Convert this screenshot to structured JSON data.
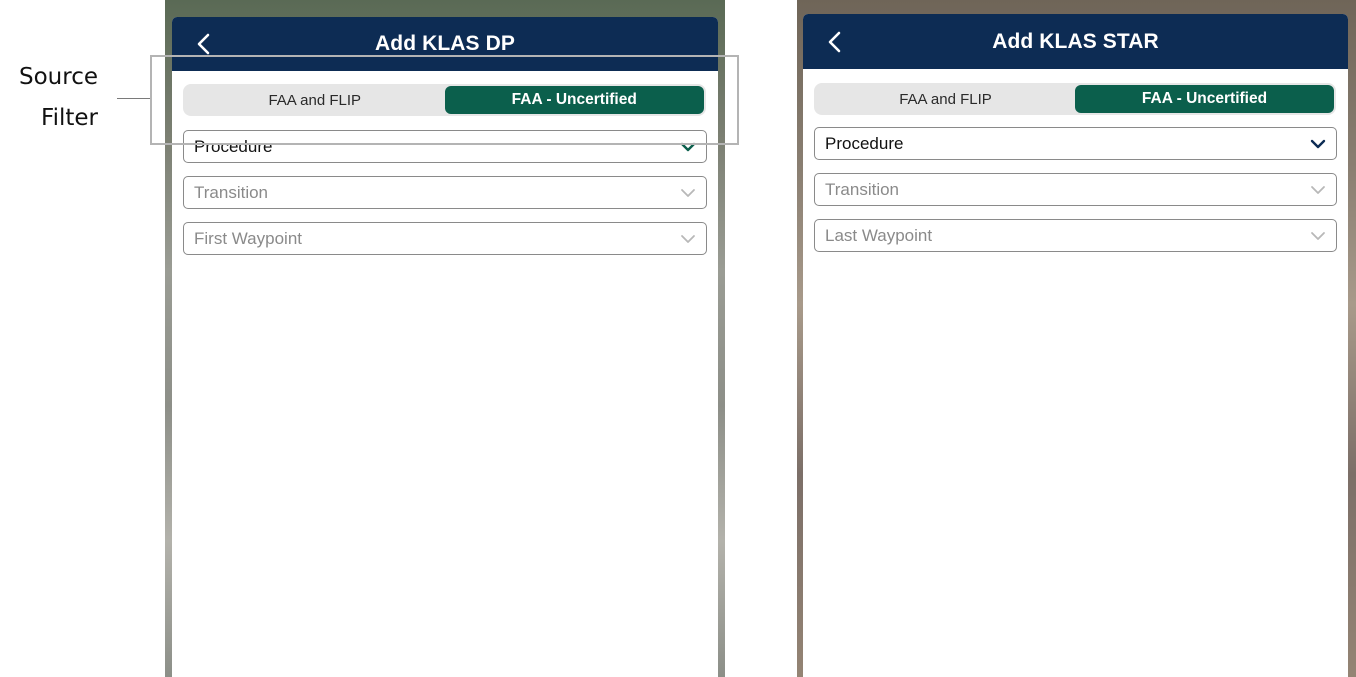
{
  "callout": {
    "line1": "Source",
    "line2": "Filter"
  },
  "panels": [
    {
      "title": "Add KLAS DP",
      "source_filter": {
        "options": [
          "FAA and FLIP",
          "FAA - Uncertified"
        ],
        "selected": "FAA - Uncertified"
      },
      "fields": [
        {
          "label": "Procedure",
          "enabled": true
        },
        {
          "label": "Transition",
          "enabled": false
        },
        {
          "label": "First Waypoint",
          "enabled": false
        }
      ]
    },
    {
      "title": "Add KLAS STAR",
      "source_filter": {
        "options": [
          "FAA and FLIP",
          "FAA - Uncertified"
        ],
        "selected": "FAA - Uncertified"
      },
      "fields": [
        {
          "label": "Procedure",
          "enabled": true
        },
        {
          "label": "Transition",
          "enabled": false
        },
        {
          "label": "Last Waypoint",
          "enabled": false
        }
      ]
    }
  ],
  "colors": {
    "header_bg": "#0d2c54",
    "selected_segment": "#0b5f4c",
    "segment_bg": "#e6e6e6",
    "chevron_enabled": "#0b5f4c",
    "chevron_disabled": "#b8b8b8",
    "callout_box": "#b4b4b4"
  },
  "icons": {
    "back": "chevron-left-icon",
    "dropdown": "chevron-down-icon"
  }
}
